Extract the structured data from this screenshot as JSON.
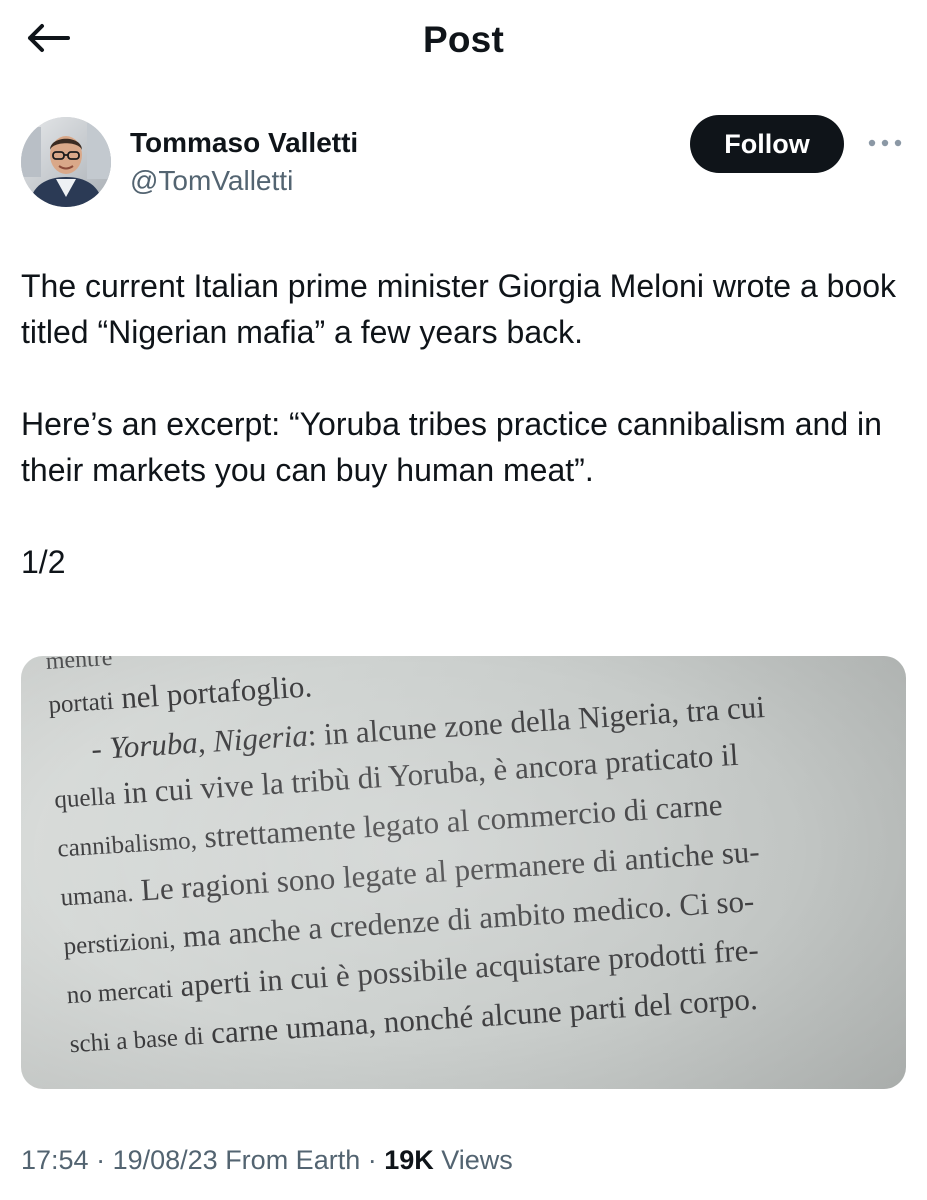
{
  "header": {
    "title": "Post"
  },
  "author": {
    "name": "Tommaso Valletti",
    "handle": "@TomValletti",
    "follow_label": "Follow"
  },
  "tweet": {
    "paragraphs": [
      "The current Italian prime minister Giorgia Meloni wrote a book titled “Nigerian mafia” a few years back.",
      "Here’s an excerpt: “Yoruba tribes practice cannibalism and in their markets you can buy human meat”.",
      "1/2"
    ]
  },
  "photo": {
    "lines": {
      "l0": "mentre",
      "l1a": "portati",
      "l1b": " nel portafoglio.",
      "l2a": "- ",
      "l2b": "Yoruba, Nigeria",
      "l2c": ": in alcune zone della Nigeria, tra cui",
      "l3a": "quella",
      "l3b": " in cui vive la tribù di Yoruba, è ancora praticato il",
      "l4a": "cannibalismo,",
      "l4b": " strettamente legato al commercio di carne",
      "l5a": "umana.",
      "l5b": " Le ragioni sono legate al permanere di antiche su-",
      "l6a": "perstizioni,",
      "l6b": " ma anche a credenze di ambito medico. Ci so-",
      "l7a": "no mercati",
      "l7b": " aperti in cui è possibile acquistare prodotti fre-",
      "l8a": "schi a base di",
      "l8b": " carne umana, nonché alcune parti del corpo."
    }
  },
  "meta": {
    "time": "17:54",
    "separator": " · ",
    "date": "19/08/23",
    "source": " From Earth",
    "views_count": "19K",
    "views_label": " Views"
  },
  "icons": {
    "back": "arrow-left-icon",
    "more": "more-horizontal-icon"
  },
  "colors": {
    "text_primary": "#0f1419",
    "text_secondary": "#536471",
    "follow_bg": "#0f1419",
    "follow_text": "#ffffff"
  }
}
